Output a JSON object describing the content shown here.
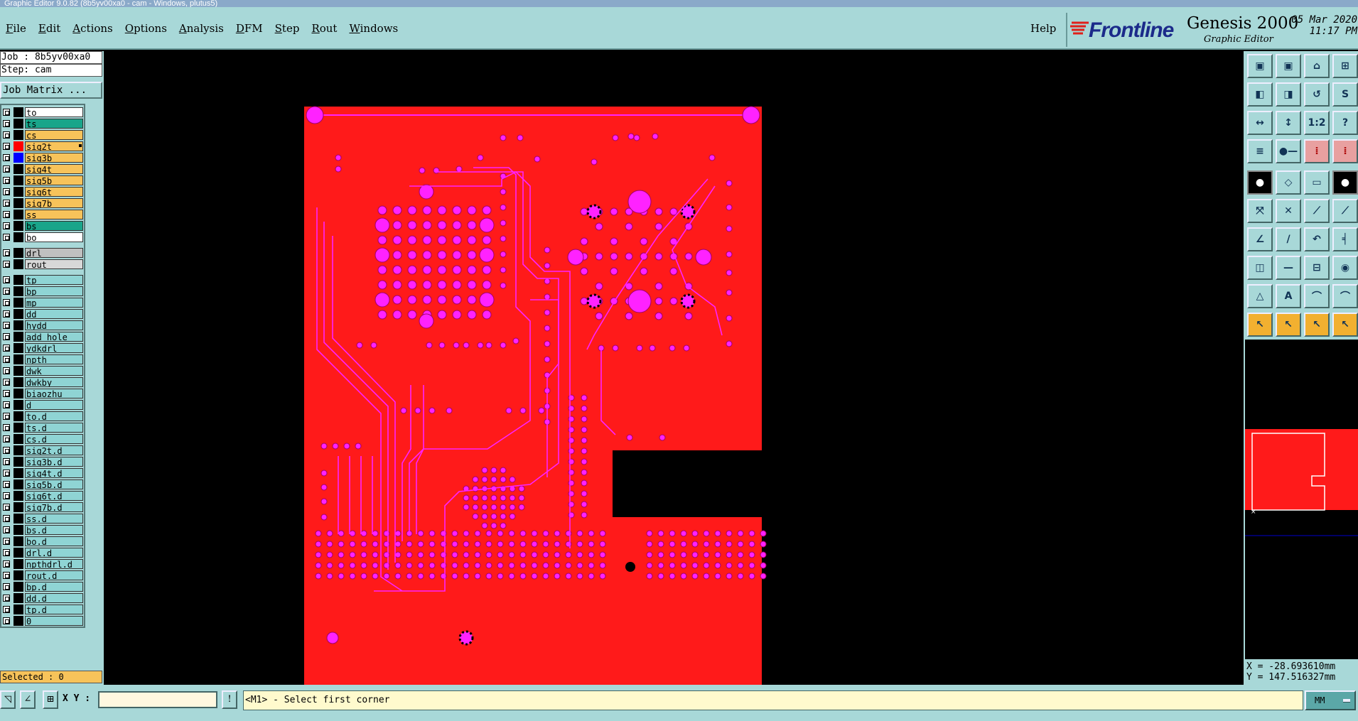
{
  "window": {
    "title": "Graphic Editor 9.0.82 (8b5yv00xa0 - cam - Windows, plutus5)"
  },
  "menu": [
    {
      "label": "File",
      "u": "F",
      "rest": "ile"
    },
    {
      "label": "Edit",
      "u": "E",
      "rest": "dit"
    },
    {
      "label": "Actions",
      "u": "A",
      "rest": "ctions"
    },
    {
      "label": "Options",
      "u": "O",
      "rest": "ptions"
    },
    {
      "label": "Analysis",
      "u": "A",
      "rest": "nalysis"
    },
    {
      "label": "DFM",
      "u": "D",
      "rest": "FM"
    },
    {
      "label": "Step",
      "u": "S",
      "rest": "tep"
    },
    {
      "label": "Rout",
      "u": "R",
      "rest": "out"
    },
    {
      "label": "Windows",
      "u": "W",
      "rest": "indows"
    }
  ],
  "help": "Help",
  "brand": {
    "name": "Frontline",
    "product": "Genesis 2000",
    "subtitle": "Graphic Editor",
    "date": "05 Mar 2020",
    "time": "11:17 PM"
  },
  "job": {
    "job_line": "Job : 8b5yv00xa0",
    "step_line": "Step: cam",
    "matrix_button": "Job Matrix ..."
  },
  "colors": {
    "panel": "#a8d8d8",
    "board": "#ff1a1a",
    "feature": "#ff22ff",
    "board_layer": "#19a58a",
    "signal_layer": "#f7c35a",
    "drill_layer": "#c0c0c0",
    "misc_layer": "#8fd4d4",
    "white_layer": "#ffffff"
  },
  "layers": [
    {
      "name": "to",
      "bg": "#ffffff",
      "sw": "#000000"
    },
    {
      "name": "ts",
      "bg": "#19a58a",
      "sw": "#000000"
    },
    {
      "name": "cs",
      "bg": "#f7c35a",
      "sw": "#000000"
    },
    {
      "name": "sig2t",
      "bg": "#f7c35a",
      "sw": "#ff0000",
      "mark": true
    },
    {
      "name": "sig3b",
      "bg": "#f7c35a",
      "sw": "#0000ff"
    },
    {
      "name": "sig4t",
      "bg": "#f7c35a",
      "sw": "#000000"
    },
    {
      "name": "sig5b",
      "bg": "#f7c35a",
      "sw": "#000000"
    },
    {
      "name": "sig6t",
      "bg": "#f7c35a",
      "sw": "#000000"
    },
    {
      "name": "sig7b",
      "bg": "#f7c35a",
      "sw": "#000000"
    },
    {
      "name": "ss",
      "bg": "#f7c35a",
      "sw": "#000000"
    },
    {
      "name": "bs",
      "bg": "#19a58a",
      "sw": "#000000"
    },
    {
      "name": "bo",
      "bg": "#ffffff",
      "sw": "#000000"
    },
    {
      "name": "drl",
      "bg": "#c0c0c0",
      "sw": "#000000",
      "gap": true
    },
    {
      "name": "rout",
      "bg": "#d8d8d8",
      "sw": "#000000"
    },
    {
      "name": "tp",
      "bg": "#8fd4d4",
      "sw": "#000000",
      "gap": true
    },
    {
      "name": "bp",
      "bg": "#8fd4d4",
      "sw": "#000000"
    },
    {
      "name": "mp",
      "bg": "#8fd4d4",
      "sw": "#000000"
    },
    {
      "name": "dd",
      "bg": "#8fd4d4",
      "sw": "#000000"
    },
    {
      "name": "hydd",
      "bg": "#8fd4d4",
      "sw": "#000000"
    },
    {
      "name": "add_hole",
      "bg": "#8fd4d4",
      "sw": "#000000"
    },
    {
      "name": "ydkdrl",
      "bg": "#8fd4d4",
      "sw": "#000000"
    },
    {
      "name": "npth",
      "bg": "#8fd4d4",
      "sw": "#000000"
    },
    {
      "name": "dwk",
      "bg": "#8fd4d4",
      "sw": "#000000"
    },
    {
      "name": "dwkby",
      "bg": "#8fd4d4",
      "sw": "#000000"
    },
    {
      "name": "biaozhu",
      "bg": "#8fd4d4",
      "sw": "#000000"
    },
    {
      "name": "d",
      "bg": "#8fd4d4",
      "sw": "#000000"
    },
    {
      "name": "to.d",
      "bg": "#8fd4d4",
      "sw": "#000000"
    },
    {
      "name": "ts.d",
      "bg": "#8fd4d4",
      "sw": "#000000"
    },
    {
      "name": "cs.d",
      "bg": "#8fd4d4",
      "sw": "#000000"
    },
    {
      "name": "sig2t.d",
      "bg": "#8fd4d4",
      "sw": "#000000"
    },
    {
      "name": "sig3b.d",
      "bg": "#8fd4d4",
      "sw": "#000000"
    },
    {
      "name": "sig4t.d",
      "bg": "#8fd4d4",
      "sw": "#000000"
    },
    {
      "name": "sig5b.d",
      "bg": "#8fd4d4",
      "sw": "#000000"
    },
    {
      "name": "sig6t.d",
      "bg": "#8fd4d4",
      "sw": "#000000"
    },
    {
      "name": "sig7b.d",
      "bg": "#8fd4d4",
      "sw": "#000000"
    },
    {
      "name": "ss.d",
      "bg": "#8fd4d4",
      "sw": "#000000"
    },
    {
      "name": "bs.d",
      "bg": "#8fd4d4",
      "sw": "#000000"
    },
    {
      "name": "bo.d",
      "bg": "#8fd4d4",
      "sw": "#000000"
    },
    {
      "name": "drl.d",
      "bg": "#8fd4d4",
      "sw": "#000000"
    },
    {
      "name": "npthdrl.d",
      "bg": "#8fd4d4",
      "sw": "#000000"
    },
    {
      "name": "rout.d",
      "bg": "#8fd4d4",
      "sw": "#000000"
    },
    {
      "name": "bp.d",
      "bg": "#8fd4d4",
      "sw": "#000000"
    },
    {
      "name": "dd.d",
      "bg": "#8fd4d4",
      "sw": "#000000"
    },
    {
      "name": "tp.d",
      "bg": "#8fd4d4",
      "sw": "#000000"
    },
    {
      "name": "0",
      "bg": "#8fd4d4",
      "sw": "#000000"
    }
  ],
  "selected": "Selected : 0",
  "tools": [
    {
      "icon": "panel-up-icon",
      "g": "▣"
    },
    {
      "icon": "panel-down-icon",
      "g": "▣"
    },
    {
      "icon": "home-icon",
      "g": "⌂"
    },
    {
      "icon": "grid-view-icon",
      "g": "⊞"
    },
    {
      "icon": "pan-left-icon",
      "g": "◧"
    },
    {
      "icon": "pan-right-icon",
      "g": "◨"
    },
    {
      "icon": "undo-zoom-icon",
      "g": "↺"
    },
    {
      "icon": "redraw-icon",
      "g": "S"
    },
    {
      "icon": "fit-width-icon",
      "g": "↔"
    },
    {
      "icon": "fit-height-icon",
      "g": "↕"
    },
    {
      "icon": "scale-1-2-icon",
      "g": "1:2"
    },
    {
      "icon": "query-icon",
      "g": "?"
    },
    {
      "icon": "features-icon",
      "g": "≡"
    },
    {
      "icon": "measure-icon",
      "g": "●—"
    },
    {
      "icon": "net-icon",
      "g": "⁞"
    },
    {
      "icon": "snap-icon",
      "g": "⁞"
    },
    {
      "icon": "pad-icon",
      "g": "●"
    },
    {
      "icon": "transform-icon",
      "g": "◇"
    },
    {
      "icon": "line-icon",
      "g": "▭"
    },
    {
      "icon": "circle-icon",
      "g": "●"
    },
    {
      "icon": "move-icon",
      "g": "⤧"
    },
    {
      "icon": "delete-icon",
      "g": "✕"
    },
    {
      "icon": "connect-icon",
      "g": "⟋"
    },
    {
      "icon": "vertex-icon",
      "g": "⟋"
    },
    {
      "icon": "angle-icon",
      "g": "∠"
    },
    {
      "icon": "slash-icon",
      "g": "/"
    },
    {
      "icon": "arc-icon",
      "g": "↶"
    },
    {
      "icon": "break-icon",
      "g": "╡"
    },
    {
      "icon": "copy-icon",
      "g": "◫"
    },
    {
      "icon": "minus-icon",
      "g": "—"
    },
    {
      "icon": "insert-icon",
      "g": "⊟"
    },
    {
      "icon": "group-icon",
      "g": "◉"
    },
    {
      "icon": "triangle-icon",
      "g": "△"
    },
    {
      "icon": "a-icon",
      "g": "A"
    },
    {
      "icon": "arch-icon",
      "g": "⌒"
    },
    {
      "icon": "arch2-icon",
      "g": "⌒"
    },
    {
      "icon": "pointer-icon",
      "g": "↖"
    },
    {
      "icon": "pointer-select-icon",
      "g": "↖"
    },
    {
      "icon": "pointer-box-icon",
      "g": "↖"
    },
    {
      "icon": "pointer-move-icon",
      "g": "↖"
    }
  ],
  "coords": {
    "x": "X = -28.693610mm",
    "y": "Y = 147.516327mm"
  },
  "bottom": {
    "xy_label": "X Y :",
    "xy_value": "",
    "prompt": "<M1> - Select first corner",
    "units": "MM"
  }
}
